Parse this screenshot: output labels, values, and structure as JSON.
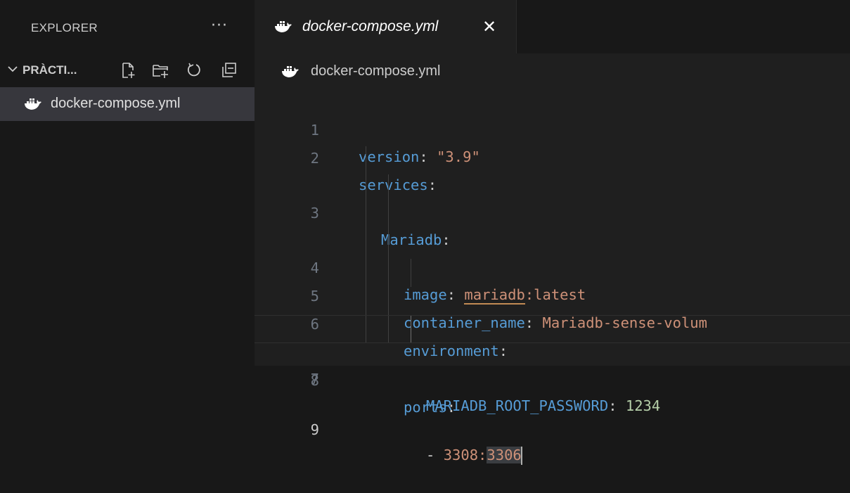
{
  "explorer": {
    "title": "EXPLORER",
    "more_label": "···",
    "section_title": "PRÀCTI...",
    "tools": [
      "new-file-icon",
      "new-folder-icon",
      "refresh-icon",
      "collapse-all-icon"
    ],
    "files": [
      {
        "name": "docker-compose.yml",
        "icon": "docker-icon",
        "selected": true
      }
    ]
  },
  "tab": {
    "label": "docker-compose.yml",
    "close": "✕",
    "icon": "docker-icon"
  },
  "breadcrumb": {
    "label": "docker-compose.yml"
  },
  "editor": {
    "current_line": 9,
    "lines": [
      {
        "num": "1",
        "key": "version",
        "colon": ":",
        "value": "\"3.9\""
      },
      {
        "num": "2",
        "key": "services",
        "colon": ":"
      },
      {
        "num": "3",
        "key": "Mariadb",
        "colon": ":"
      },
      {
        "num": "4",
        "key": "image",
        "colon": ":",
        "value_a": "mariadb",
        "value_b": ":latest"
      },
      {
        "num": "5",
        "key": "container_name",
        "colon": ":",
        "value": "Mariadb-sense-volum"
      },
      {
        "num": "6",
        "key": "environment",
        "colon": ":"
      },
      {
        "num": "7",
        "key": "MARIADB_ROOT_PASSWORD",
        "colon": ":",
        "value": "1234"
      },
      {
        "num": "8",
        "key": "ports",
        "colon": ":"
      },
      {
        "num": "9",
        "dash": "- ",
        "value_a": "3308:",
        "value_b": "3306"
      }
    ]
  },
  "colors": {
    "keyword": "#569cd6",
    "string": "#ce9178",
    "number": "#b5cea8",
    "sidebar_bg": "#181818",
    "editor_bg": "#1f1f1f",
    "selection": "#37373d"
  }
}
